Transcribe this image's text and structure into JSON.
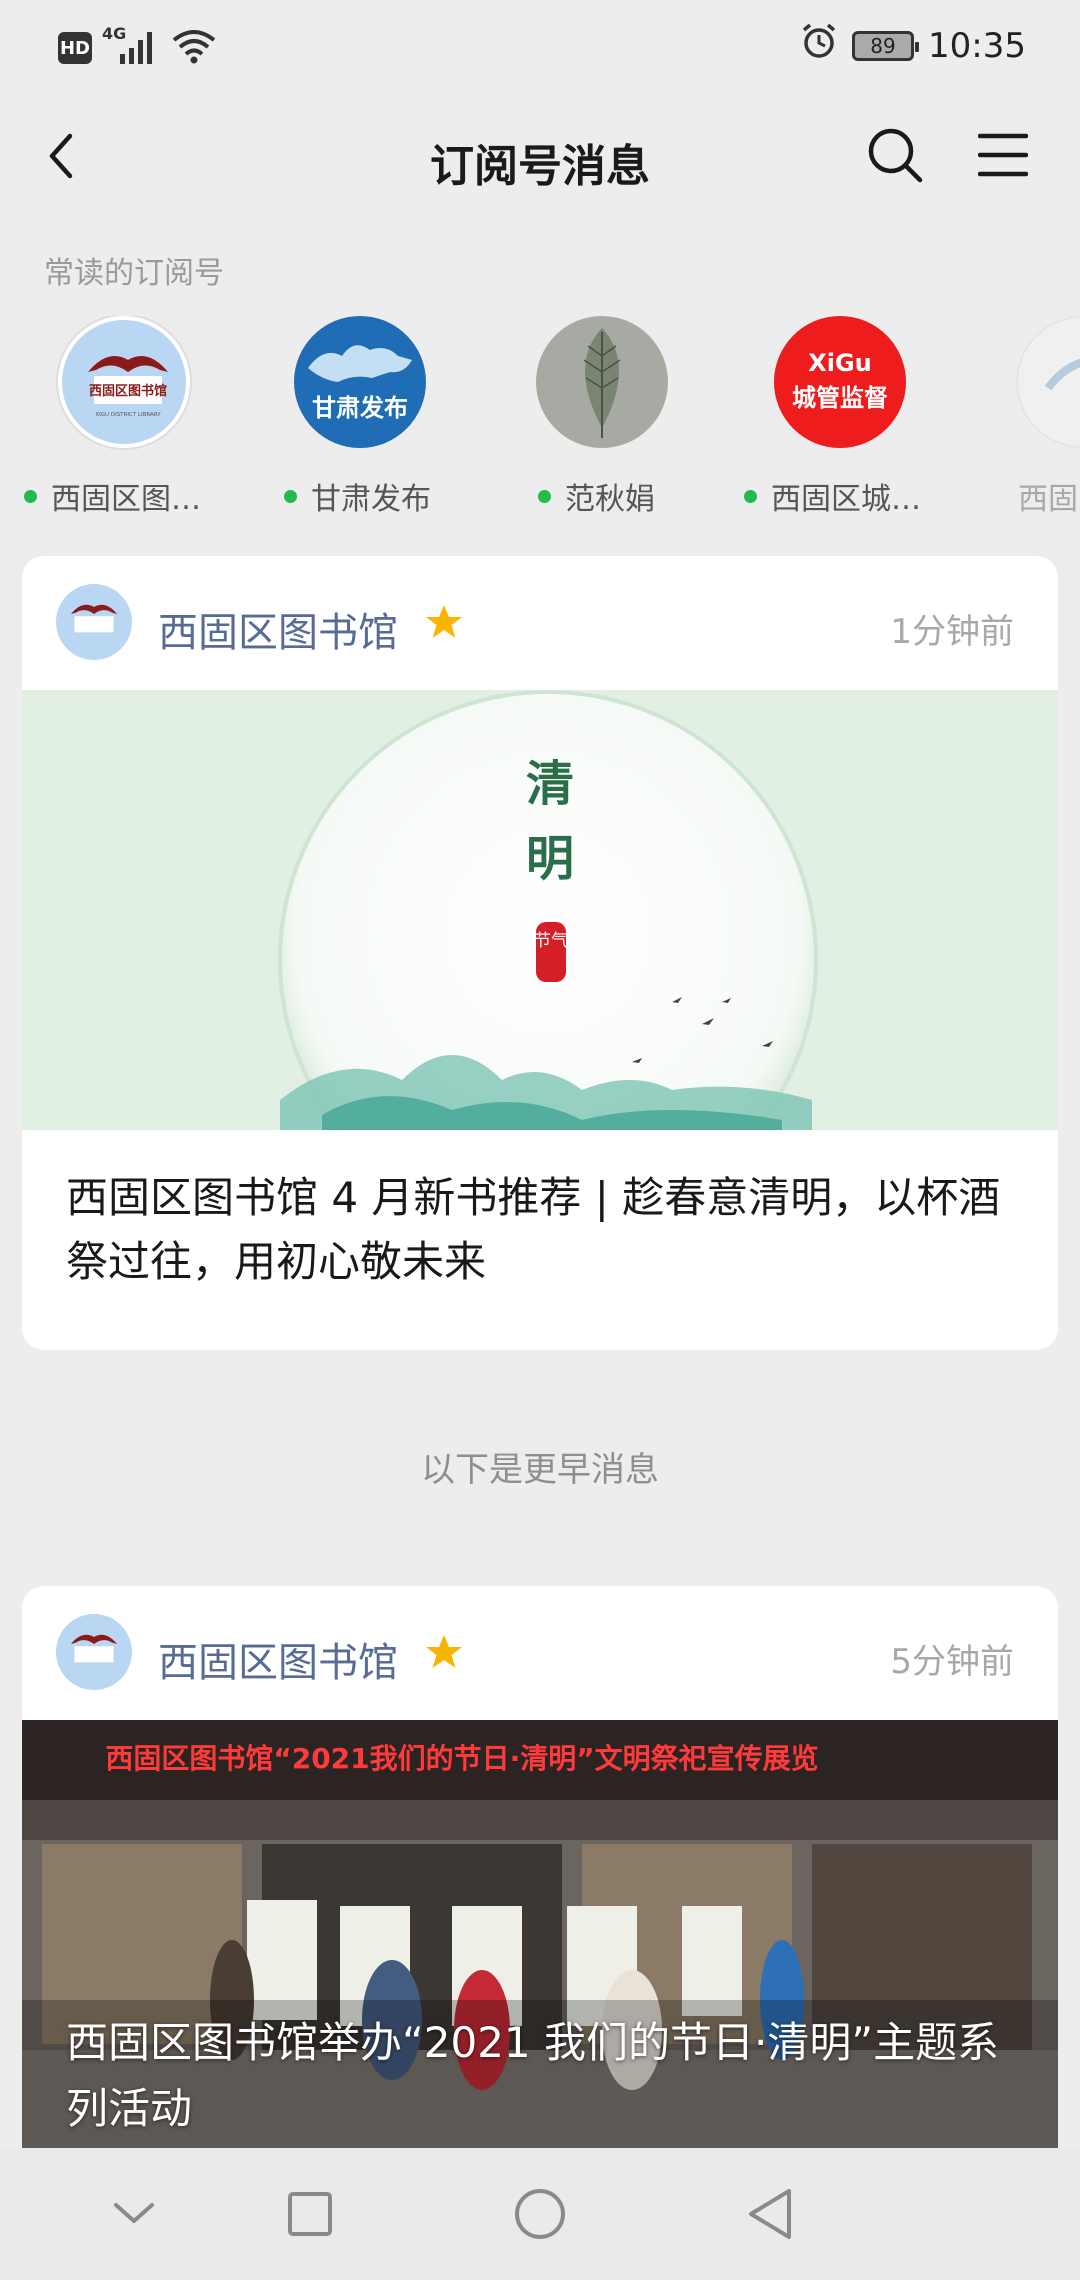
{
  "status_bar": {
    "network": "4G",
    "hd_badge": "HD",
    "battery": "89",
    "time": "10:35",
    "icons": [
      "hd-icon",
      "signal-icon",
      "wifi-icon",
      "alarm-icon",
      "battery-icon"
    ]
  },
  "header": {
    "title": "订阅号消息",
    "icons": [
      "back-icon",
      "search-icon",
      "menu-icon"
    ]
  },
  "frequent": {
    "label": "常读的订阅号",
    "items": [
      {
        "name": "西固区图…",
        "logo_text": "西固区图书馆",
        "logo_sub": "XIGU DISTRICT LIBRARY",
        "unread": true
      },
      {
        "name": "甘肃发布",
        "logo_text": "甘肃发布",
        "unread": true
      },
      {
        "name": "范秋娟",
        "unread": true
      },
      {
        "name": "西固区城…",
        "logo_text_top": "XiGu",
        "logo_text": "城管监督",
        "unread": true
      },
      {
        "name": "西固",
        "unread": false
      }
    ]
  },
  "cards": [
    {
      "account": "西固区图书馆",
      "time": "1分钟前",
      "cover_text_1": "清",
      "cover_text_2": "明",
      "cover_seal": "节气",
      "title": "西固区图书馆 4 月新书推荐 | 趁春意清明，以杯酒祭过往，用初心敬未来"
    },
    {
      "account": "西固区图书馆",
      "time": "5分钟前",
      "cover_banner": "西固区图书馆“2021我们的节日·清明”文明祭祀宣传展览",
      "title": "西固区图书馆举办“2021 我们的节日·清明”主题系列活动"
    }
  ],
  "earlier_divider": "以下是更早消息",
  "navbar": {
    "icons": [
      "hide-keyboard-icon",
      "recents-icon",
      "home-icon",
      "back-nav-icon"
    ]
  },
  "colors": {
    "account_name": "#576b95",
    "star": "#f7b500",
    "unread_dot": "#22bb4d",
    "background": "#ededed"
  }
}
